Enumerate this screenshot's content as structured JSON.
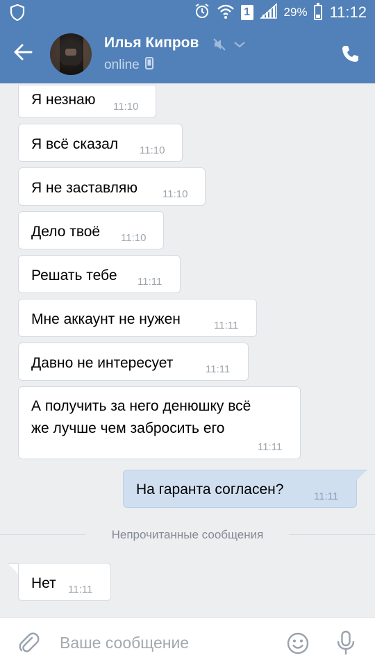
{
  "status_bar": {
    "sim": "1",
    "battery": "29%",
    "battery_level": 0.29,
    "time": "11:12"
  },
  "header": {
    "contact_name": "Илья Кипров",
    "status": "online"
  },
  "messages": [
    {
      "dir": "in",
      "text": "Я незнаю",
      "time": "11:10"
    },
    {
      "dir": "in",
      "text": "Я всё сказал",
      "time": "11:10"
    },
    {
      "dir": "in",
      "text": "Я не заставляю",
      "time": "11:10"
    },
    {
      "dir": "in",
      "text": "Дело твоё",
      "time": "11:10"
    },
    {
      "dir": "in",
      "text": "Решать тебе",
      "time": "11:11"
    },
    {
      "dir": "in",
      "text": "Мне аккаунт не нужен",
      "time": "11:11"
    },
    {
      "dir": "in",
      "text": "Давно не интересует",
      "time": "11:11"
    },
    {
      "dir": "in",
      "text_line1": "А получить за него денюшку всё",
      "text_line2": "же лучше чем забросить его",
      "time": "11:11"
    },
    {
      "dir": "out",
      "text": "На гаранта согласен?",
      "time": "11:11"
    },
    {
      "dir": "in",
      "text": "Нет",
      "time": "11:11"
    }
  ],
  "unread_divider": "Непрочитанные сообщения",
  "composer": {
    "placeholder": "Ваше сообщение"
  },
  "colors": {
    "header_bg": "#5181b8",
    "chat_bg": "#edeef0",
    "incoming_bubble": "#ffffff",
    "outgoing_bubble": "#cfdff0"
  },
  "icons": {
    "status_left": "shield-icon",
    "back": "back-arrow-icon",
    "mute": "muted-speaker-icon",
    "chevron": "chevron-down-icon",
    "device": "mobile-phone-icon",
    "call": "phone-call-icon",
    "attach": "paperclip-icon",
    "emoji": "smiley-icon",
    "mic": "microphone-icon"
  }
}
